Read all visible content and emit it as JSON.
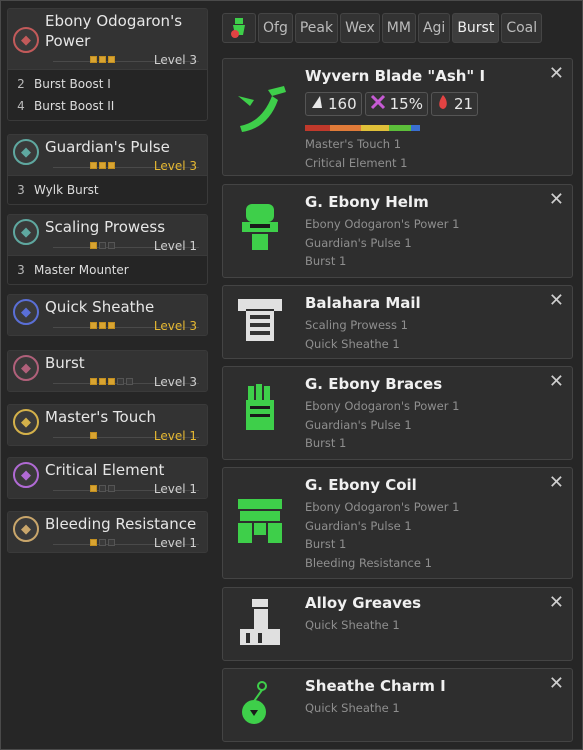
{
  "skills": [
    {
      "name": "Ebony Odogaron's Power",
      "pips": 3,
      "max": 3,
      "level_label": "Level 3",
      "maxed": false,
      "icon_color": "#c25a5a",
      "bonuses": [
        {
          "n": "2",
          "label": "Burst Boost I"
        },
        {
          "n": "4",
          "label": "Burst Boost II"
        }
      ]
    },
    {
      "name": "Guardian's Pulse",
      "pips": 3,
      "max": 3,
      "level_label": "Level 3",
      "maxed": true,
      "icon_color": "#5fa8a0",
      "bonuses": [
        {
          "n": "3",
          "label": "Wylk Burst"
        }
      ]
    },
    {
      "name": "Scaling Prowess",
      "pips": 1,
      "max": 3,
      "level_label": "Level 1",
      "maxed": false,
      "icon_color": "#5fa8a0",
      "bonuses": [
        {
          "n": "3",
          "label": "Master Mounter"
        }
      ]
    },
    {
      "name": "Quick Sheathe",
      "pips": 3,
      "max": 3,
      "level_label": "Level 3",
      "maxed": true,
      "icon_color": "#5a6fd6",
      "bonuses": []
    },
    {
      "name": "Burst",
      "pips": 3,
      "max": 5,
      "level_label": "Level 3",
      "maxed": false,
      "icon_color": "#b0607a",
      "bonuses": []
    },
    {
      "name": "Master's Touch",
      "pips": 1,
      "max": 1,
      "level_label": "Level 1",
      "maxed": true,
      "icon_color": "#d4b14a",
      "bonuses": []
    },
    {
      "name": "Critical Element",
      "pips": 1,
      "max": 3,
      "level_label": "Level 1",
      "maxed": false,
      "icon_color": "#b06ad4",
      "bonuses": []
    },
    {
      "name": "Bleeding Resistance",
      "pips": 1,
      "max": 3,
      "level_label": "Level 1",
      "maxed": false,
      "icon_color": "#c9a66b",
      "bonuses": []
    }
  ],
  "filters": [
    "Ofg",
    "Peak",
    "Wex",
    "MM",
    "Agi",
    "Burst",
    "Coal"
  ],
  "active_filter": "Burst",
  "close_glyph": "✕",
  "equipment": [
    {
      "name": "Wyvern Blade \"Ash\" I",
      "type": "weapon",
      "color": "#3ecf4a",
      "stats": {
        "attack": "160",
        "affinity": "15%",
        "element": "21"
      },
      "sharpness": [
        [
          "#c0392b",
          18
        ],
        [
          "#e07b39",
          22
        ],
        [
          "#e0c039",
          20
        ],
        [
          "#5cbf3a",
          16
        ],
        [
          "#3a6fd1",
          6
        ]
      ],
      "skills": [
        "Master's Touch 1",
        "Critical Element 1"
      ]
    },
    {
      "name": "G. Ebony Helm",
      "type": "helm",
      "color": "#3ecf4a",
      "skills": [
        "Ebony Odogaron's Power 1",
        "Guardian's Pulse 1",
        "Burst 1"
      ]
    },
    {
      "name": "Balahara Mail",
      "type": "mail",
      "color": "#e0e0e0",
      "skills": [
        "Scaling Prowess 1",
        "Quick Sheathe 1"
      ]
    },
    {
      "name": "G. Ebony Braces",
      "type": "braces",
      "color": "#3ecf4a",
      "skills": [
        "Ebony Odogaron's Power 1",
        "Guardian's Pulse 1",
        "Burst 1"
      ]
    },
    {
      "name": "G. Ebony Coil",
      "type": "coil",
      "color": "#3ecf4a",
      "skills": [
        "Ebony Odogaron's Power 1",
        "Guardian's Pulse 1",
        "Burst 1",
        "Bleeding Resistance 1"
      ]
    },
    {
      "name": "Alloy Greaves",
      "type": "greaves",
      "color": "#e0e0e0",
      "skills": [
        "Quick Sheathe 1"
      ]
    },
    {
      "name": "Sheathe Charm I",
      "type": "charm",
      "color": "#3ecf4a",
      "skills": [
        "Quick Sheathe 1"
      ]
    }
  ]
}
